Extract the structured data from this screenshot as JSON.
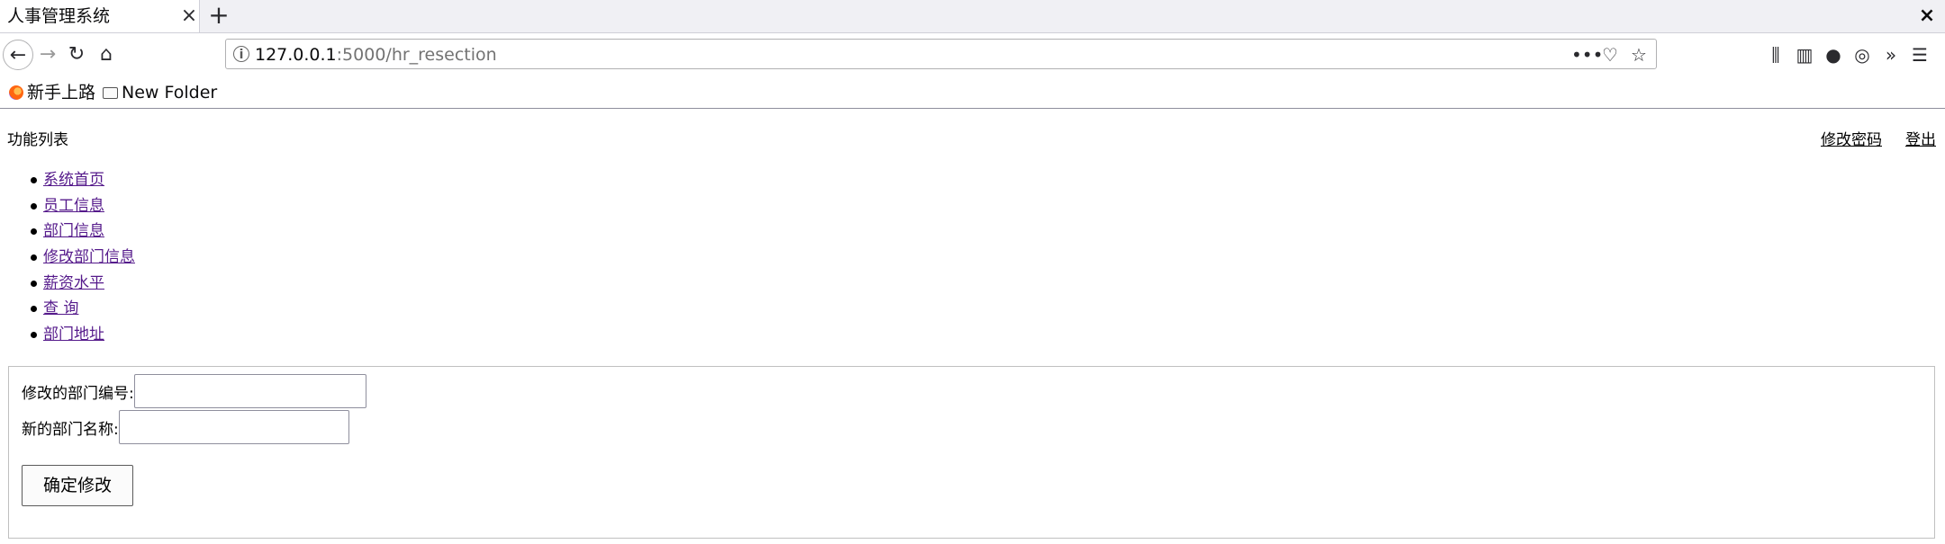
{
  "browser": {
    "tab_title": "人事管理系统",
    "tab_close": "×",
    "new_tab": "+",
    "window_close": "×",
    "url_host": "127.0.0.1",
    "url_path": ":5000/hr_resection",
    "nav": {
      "back": "←",
      "forward": "→",
      "reload": "↻",
      "home": "⌂"
    },
    "url_icons": {
      "more": "•••",
      "pocket": "♡",
      "bookmark": "☆"
    },
    "toolbar_icons": {
      "library": "⫼",
      "sidebar": "▥",
      "account": "●",
      "extension": "◎",
      "overflow": "»",
      "menu": "☰"
    },
    "bookmarks": [
      {
        "label": "新手上路",
        "icon": "firefox-icon"
      },
      {
        "label": "New Folder",
        "icon": "folder-icon"
      }
    ]
  },
  "page": {
    "func_title": "功能列表",
    "top_links": [
      "修改密码",
      "登出"
    ],
    "menu": [
      "系统首页",
      "员工信息",
      "部门信息",
      "修改部门信息",
      "薪资水平",
      "查 询",
      "部门地址"
    ],
    "form": {
      "dept_id_label": "修改的部门编号:",
      "dept_id_value": "",
      "dept_name_label": "新的部门名称:",
      "dept_name_value": "",
      "submit_label": "确定修改"
    }
  }
}
